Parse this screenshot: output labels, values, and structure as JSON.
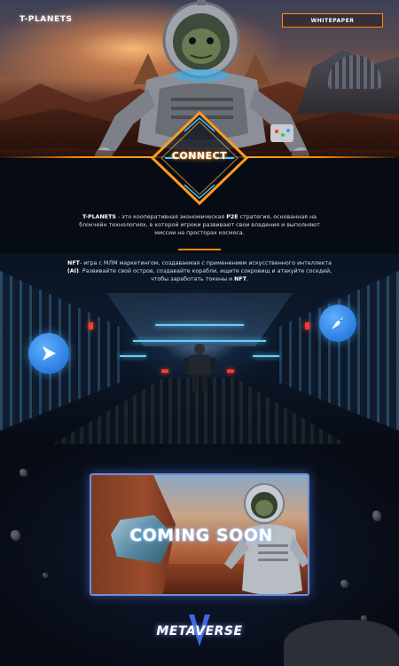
{
  "header": {
    "logo": "T-PLANETS",
    "whitepaper_label": "WHITEPAPER"
  },
  "hero": {
    "connect_label": "CONNECT"
  },
  "intro": {
    "p1_brand": "T-PLANETS",
    "p1_text": " - это кооперативная экономическая ",
    "p1_bold2": "P2E",
    "p1_text2": " стратегия, основанная на блокчейн технологиях, в которой игроки развивают свои владения и выполняют миссии на просторах космоса.",
    "p2_bold": "NFT",
    "p2_text": "- игра с МЛМ маркетингом, создаваемая с применением искусственного интеллекта ",
    "p2_bold2": "(AI)",
    "p2_text2": ". Развивайте свой остров, создавайте корабли, ищите сокровищ и атакуйте соседей, чтобы заработать токены и ",
    "p2_bold3": "NFT",
    "p2_text3": "."
  },
  "corridor": {
    "left_button_icon": "play-icon",
    "right_button_icon": "rocket-icon"
  },
  "coming_soon": {
    "label": "COMING SOON"
  },
  "footer": {
    "metaverse_label": "METAVERSE"
  },
  "colors": {
    "accent": "#ff8a10",
    "background": "#070b14",
    "button_blue": "#2a7de0",
    "card_border": "#6f8fd8"
  }
}
